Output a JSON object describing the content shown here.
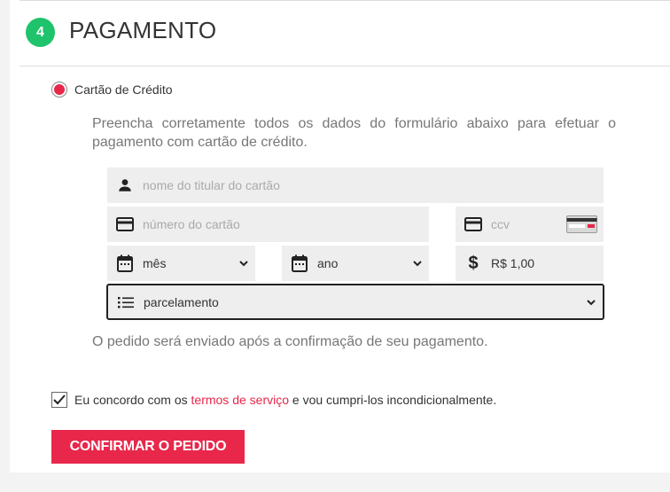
{
  "section": {
    "step_number": "4",
    "title": "PAGAMENTO"
  },
  "payment_method": {
    "label": "Cartão de Crédito",
    "selected": true
  },
  "instructions": "Preencha corretamente todos os dados do formulário abaixo para efetuar o pagamento com cartão de crédito.",
  "form": {
    "cardholder_placeholder": "nome do titular do cartão",
    "card_number_placeholder": "número do cartão",
    "ccv_placeholder": "ccv",
    "month_value": "mês",
    "year_value": "ano",
    "amount_value": "R$ 1,00",
    "installments_value": "parcelamento"
  },
  "note": "O pedido será enviado após a confirmação de seu pagamento.",
  "terms": {
    "prefix": "Eu concordo com os",
    "link": "termos de serviço",
    "suffix": "e vou cumpri-los incondicionalmente.",
    "checked": true
  },
  "confirm_button": "CONFIRMAR O PEDIDO",
  "colors": {
    "accent": "#e8274b",
    "step_badge": "#1ec36b",
    "field_bg": "#eeeeee"
  },
  "icons": [
    "user-icon",
    "credit-card-icon",
    "calendar-icon",
    "dollar-icon",
    "list-icon",
    "chevron-down-icon",
    "check-icon",
    "card-image-icon"
  ]
}
